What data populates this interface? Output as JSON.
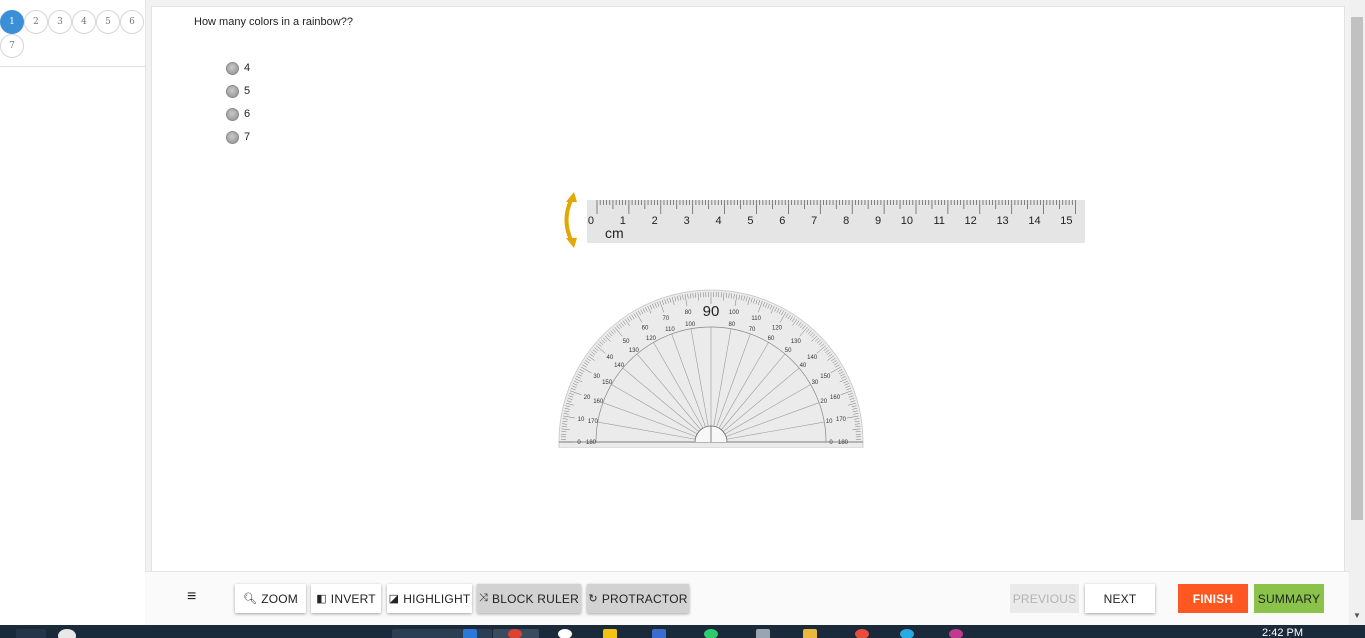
{
  "question_nav": {
    "items": [
      "1",
      "2",
      "3",
      "4",
      "5",
      "6",
      "7"
    ],
    "active": "1"
  },
  "question": {
    "text": "How many colors in a rainbow??",
    "options": [
      "4",
      "5",
      "6",
      "7"
    ]
  },
  "ruler": {
    "unit": "cm",
    "ticks": [
      "0",
      "1",
      "2",
      "3",
      "4",
      "5",
      "6",
      "7",
      "8",
      "9",
      "10",
      "11",
      "12",
      "13",
      "14",
      "15"
    ]
  },
  "protractor": {
    "center_label": "90"
  },
  "toolbar": {
    "menu_icon": "hamburger-menu-icon",
    "zoom_label": "ZOOM",
    "invert_label": "INVERT",
    "highlight_label": "HIGHLIGHT",
    "block_ruler_label": "BLOCK RULER",
    "protractor_label": "PROTRACTOR",
    "previous_label": "PREVIOUS",
    "next_label": "NEXT",
    "finish_label": "FINISH",
    "summary_label": "SUMMARY"
  },
  "colors": {
    "accent": "#3b8fd6",
    "finish": "#ff5722",
    "summary": "#8bc34a",
    "ruler_arrow": "#e6a600"
  },
  "taskbar": {
    "clock": "2:42 PM"
  }
}
